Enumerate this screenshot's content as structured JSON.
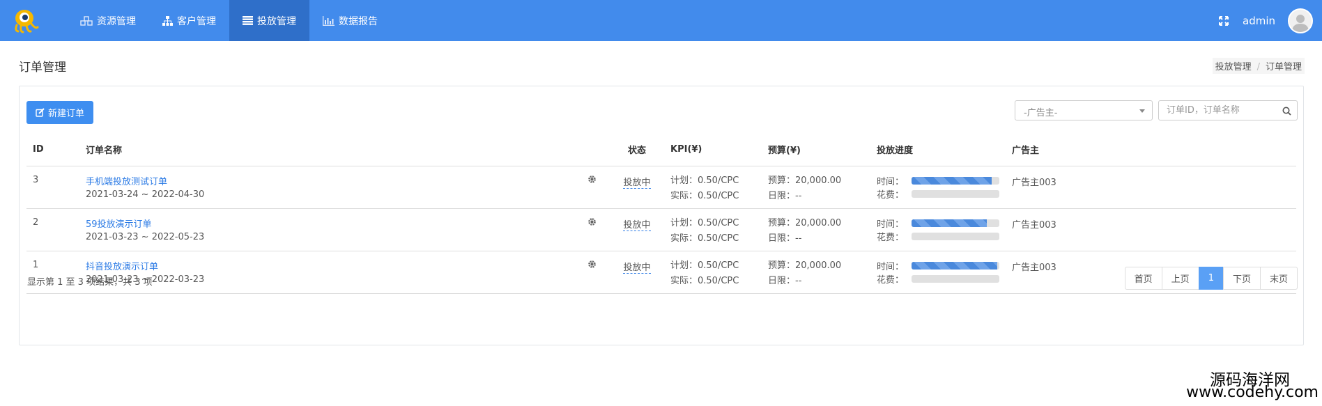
{
  "nav": {
    "items": [
      {
        "label": "资源管理",
        "icon": "cubes-icon",
        "active": false
      },
      {
        "label": "客户管理",
        "icon": "sitemap-icon",
        "active": false
      },
      {
        "label": "投放管理",
        "icon": "list-icon",
        "active": true
      },
      {
        "label": "数据报告",
        "icon": "bar-chart-icon",
        "active": false
      }
    ],
    "user": "admin"
  },
  "page": {
    "title": "订单管理",
    "breadcrumb": [
      "投放管理",
      "订单管理"
    ],
    "new_button": "新建订单",
    "advertiser_select": "-广告主-",
    "search_placeholder": "订单ID，订单名称"
  },
  "table": {
    "headers": [
      "ID",
      "订单名称",
      "状态",
      "KPI(¥)",
      "预算(¥)",
      "投放进度",
      "广告主"
    ],
    "rows": [
      {
        "id": "3",
        "name": "手机端投放测试订单",
        "period": "2021-03-24 ~ 2022-04-30",
        "status": "投放中",
        "kpi_plan": "计划：0.50/CPC",
        "kpi_actual": "实际：0.50/CPC",
        "budget": "预算：20,000.00",
        "daily": "日限：--",
        "time_label": "时间：",
        "cost_label": "花费：",
        "time_progress": 0.91,
        "cost_progress": 0,
        "advertiser": "广告主003"
      },
      {
        "id": "2",
        "name": "59投放演示订单",
        "period": "2021-03-23 ~ 2022-05-23",
        "status": "投放中",
        "kpi_plan": "计划：0.50/CPC",
        "kpi_actual": "实际：0.50/CPC",
        "budget": "预算：20,000.00",
        "daily": "日限：--",
        "time_label": "时间：",
        "cost_label": "花费：",
        "time_progress": 0.86,
        "cost_progress": 0,
        "advertiser": "广告主003"
      },
      {
        "id": "1",
        "name": "抖音投放演示订单",
        "period": "2021-03-23 ~ 2022-03-23",
        "status": "投放中",
        "kpi_plan": "计划：0.50/CPC",
        "kpi_actual": "实际：0.50/CPC",
        "budget": "预算：20,000.00",
        "daily": "日限：--",
        "time_label": "时间：",
        "cost_label": "花费：",
        "time_progress": 0.98,
        "cost_progress": 0,
        "advertiser": "广告主003"
      }
    ]
  },
  "footer": {
    "info": "显示第 1 至 3 项结果，共 3 项",
    "pager": [
      {
        "label": "首页",
        "active": false
      },
      {
        "label": "上页",
        "active": false
      },
      {
        "label": "1",
        "active": true
      },
      {
        "label": "下页",
        "active": false
      },
      {
        "label": "末页",
        "active": false
      }
    ]
  },
  "watermark": {
    "line1": "源码海洋网",
    "line2": "www.codehy.com"
  },
  "colors": {
    "topbar": "#428bec",
    "nav_active": "#2f6fc9",
    "primary_button": "#3e8ef0",
    "link": "#2c7be5"
  }
}
